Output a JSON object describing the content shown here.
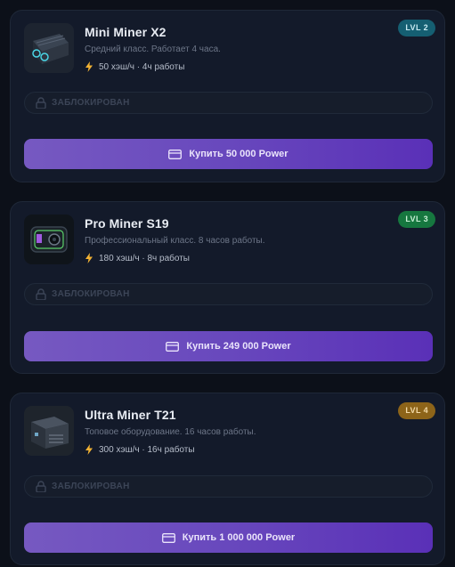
{
  "miners": [
    {
      "name": "Mini Miner X2",
      "description": "Средний класс. Работает 4 часа.",
      "stats": "50 хэш/ч · 4ч работы",
      "level": "LVL 2",
      "locked_label": "ЗАБЛОКИРОВАН",
      "buy_label": "Купить 50 000 Power",
      "image_icon": "mini-miner-device-icon"
    },
    {
      "name": "Pro Miner S19",
      "description": "Профессиональный класс. 8 часов работы.",
      "stats": "180 хэш/ч · 8ч работы",
      "level": "LVL 3",
      "locked_label": "ЗАБЛОКИРОВАН",
      "buy_label": "Купить 249 000 Power",
      "image_icon": "pro-miner-device-icon"
    },
    {
      "name": "Ultra Miner T21",
      "description": "Топовое оборудование. 16 часов работы.",
      "stats": "300 хэш/ч · 16ч работы",
      "level": "LVL 4",
      "locked_label": "ЗАБЛОКИРОВАН",
      "buy_label": "Купить 1 000 000 Power",
      "image_icon": "ultra-miner-device-icon"
    }
  ],
  "colors": {
    "background": "#0c1019",
    "card": "#131a2a",
    "lvl2_badge": "#155f72",
    "lvl3_badge": "#16773f",
    "lvl4_badge": "#8d6419",
    "buy_button_from": "#7659c1",
    "buy_button_to": "#5a30b7",
    "bolt": "#f2b233"
  }
}
